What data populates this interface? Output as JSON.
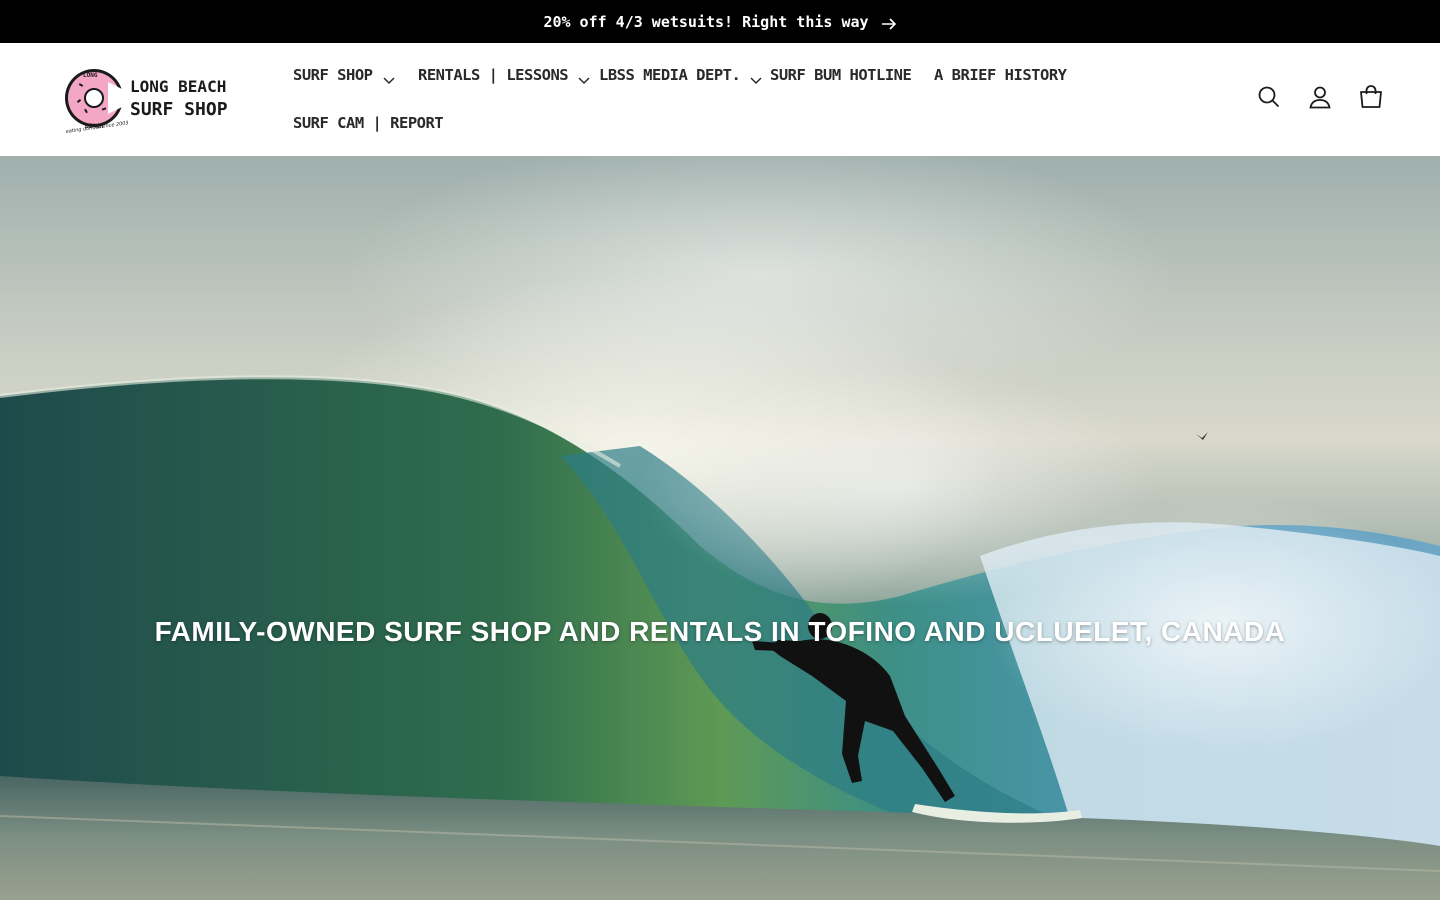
{
  "announcement": {
    "text": "20% off 4/3 wetsuits! Right this way"
  },
  "header": {
    "logo": {
      "line1": "LONG BEACH",
      "line2": "SURF SHOP",
      "badge_top": "LONG",
      "badge_bottom": "BEACH",
      "tagline": "eating donuts since 2003",
      "accent_color": "#f4a7c4"
    },
    "nav": [
      {
        "label": "SURF SHOP",
        "has_dropdown": true
      },
      {
        "label": "RENTALS | LESSONS",
        "has_dropdown": true
      },
      {
        "label": "LBSS MEDIA DEPT.",
        "has_dropdown": true
      },
      {
        "label": "SURF BUM HOTLINE",
        "has_dropdown": false
      },
      {
        "label": "A BRIEF HISTORY",
        "has_dropdown": false
      },
      {
        "label": "SURF CAM | REPORT",
        "has_dropdown": false
      }
    ],
    "icons": [
      "search-icon",
      "account-icon",
      "cart-icon"
    ]
  },
  "hero": {
    "heading": "FAMILY-OWNED SURF SHOP AND RENTALS IN TOFINO AND UCLUELET, CANADA"
  }
}
